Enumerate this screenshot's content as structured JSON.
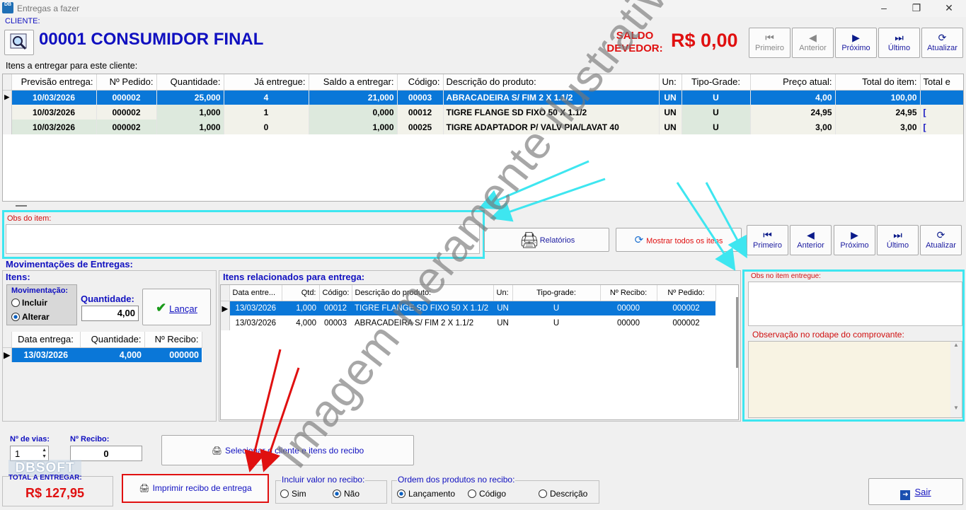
{
  "window": {
    "title": "Entregas a fazer",
    "app_icon": "DB"
  },
  "client": {
    "label": "CLIENTE:",
    "name": "00001 CONSUMIDOR FINAL",
    "saldo_label_1": "SALDO",
    "saldo_label_2": "DEVEDOR:",
    "saldo_value": "R$ 0,00"
  },
  "nav_top": {
    "first": "Primeiro",
    "prev": "Anterior",
    "next": "Próximo",
    "last": "Último",
    "refresh": "Atualizar"
  },
  "items_section": {
    "title": "Itens a entregar para este cliente:",
    "columns": [
      "Previsão entrega:",
      "Nº Pedido:",
      "Quantidade:",
      "Já entregue:",
      "Saldo a entregar:",
      "Código:",
      "Descrição do produto:",
      "Un:",
      "Tipo-Grade:",
      "Preço atual:",
      "Total do item:",
      "Total e"
    ],
    "rows": [
      [
        "10/03/2026",
        "000002",
        "25,000",
        "4",
        "21,000",
        "00003",
        "ABRACADEIRA S/ FIM 2 X 1.1/2",
        "UN",
        "U",
        "4,00",
        "100,00",
        ""
      ],
      [
        "10/03/2026",
        "000002",
        "1,000",
        "1",
        "0,000",
        "00012",
        "TIGRE FLANGE SD FIXO 50 X 1.1/2",
        "UN",
        "U",
        "24,95",
        "24,95",
        "["
      ],
      [
        "10/03/2026",
        "000002",
        "1,000",
        "0",
        "1,000",
        "00025",
        "TIGRE ADAPTADOR P/ VALV PIA/LAVAT 40",
        "UN",
        "U",
        "3,00",
        "3,00",
        "["
      ]
    ]
  },
  "obs_item": {
    "label": "Obs do item:",
    "value": ""
  },
  "buttons": {
    "relatorios": "Relatórios",
    "mostrar_todos": "Mostrar todos os itens",
    "lancar": "Lançar",
    "selecionar": "Selecionar o cliente e itens do recibo",
    "imprimir": "Imprimir recibo de entrega",
    "sair": "Sair"
  },
  "nav_mid": {
    "first": "Primeiro",
    "prev": "Anterior",
    "next": "Próximo",
    "last": "Último",
    "refresh": "Atualizar"
  },
  "movimentacoes": {
    "title": "Movimentações de Entregas:",
    "itens_label": "Itens:",
    "mov_label": "Movimentação:",
    "incluir": "Incluir",
    "alterar": "Alterar",
    "selected": "Alterar",
    "quantidade_label": "Quantidade:",
    "quantidade_value": "4,00",
    "columns": [
      "Data entrega:",
      "Quantidade:",
      "Nº Recibo:"
    ],
    "rows": [
      [
        "13/03/2026",
        "4,000",
        "000000"
      ]
    ]
  },
  "related": {
    "title": "Itens relacionados para entrega:",
    "columns": [
      "Data entre...",
      "Qtd:",
      "Código:",
      "Descrição do produto:",
      "Un:",
      "Tipo-grade:",
      "Nº Recibo:",
      "Nº Pedido:"
    ],
    "rows": [
      [
        "13/03/2026",
        "1,000",
        "00012",
        "TIGRE FLANGE SD FIXO 50 X 1.1/2",
        "UN",
        "U",
        "00000",
        "000002"
      ],
      [
        "13/03/2026",
        "4,000",
        "00003",
        "ABRACADEIRA S/ FIM 2 X 1.1/2",
        "UN",
        "U",
        "00000",
        "000002"
      ]
    ]
  },
  "obs_entregue": {
    "label": "Obs no item entregue:",
    "value": ""
  },
  "obs_rodape": {
    "label": "Observação no rodape do comprovante:",
    "value": ""
  },
  "bottom": {
    "vias_label": "Nº de vias:",
    "vias_value": "1",
    "recibo_label": "Nº Recibo:",
    "recibo_value": "0",
    "total_label": "TOTAL A ENTREGAR:",
    "total_value": "R$ 127,95",
    "logo": "DBSOFT",
    "incluir_valor_label": "Incluir valor no recibo:",
    "sim": "Sim",
    "nao": "Não",
    "incluir_valor_selected": "Não",
    "ordem_label": "Ordem dos produtos no recibo:",
    "lancamento": "Lançamento",
    "codigo": "Código",
    "descricao": "Descrição",
    "ordem_selected": "Lançamento"
  },
  "watermark": "Imagem meramente ilustrativa",
  "colors": {
    "accent_blue": "#0a77d8",
    "title_blue": "#1010c0",
    "red": "#e01010",
    "cyan": "#3ee6f0"
  }
}
